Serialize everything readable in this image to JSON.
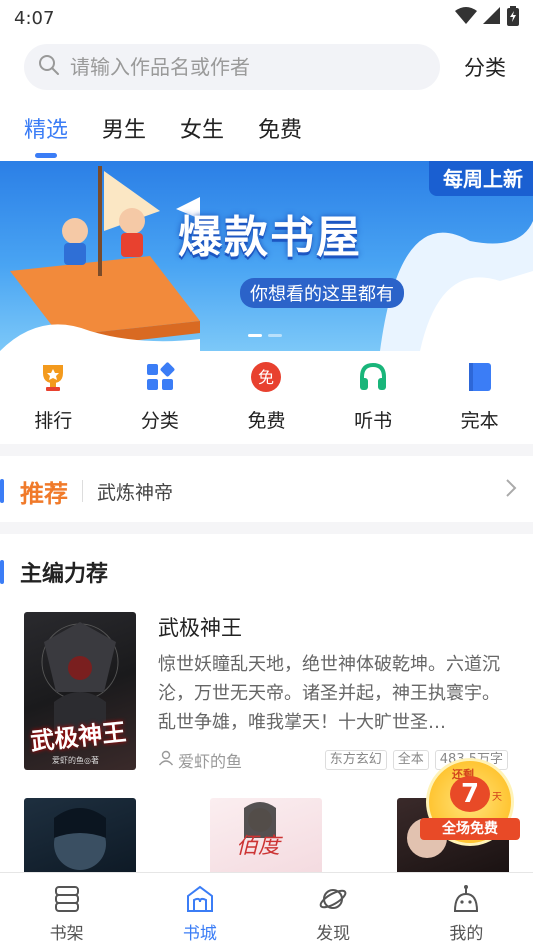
{
  "status_bar": {
    "time": "4:07"
  },
  "search": {
    "placeholder": "请输入作品名或作者",
    "category_link": "分类"
  },
  "tabs": [
    {
      "label": "精选",
      "active": true
    },
    {
      "label": "男生",
      "active": false
    },
    {
      "label": "女生",
      "active": false
    },
    {
      "label": "免费",
      "active": false
    }
  ],
  "banner": {
    "tag": "每周上新",
    "title": "爆款书屋",
    "subtitle": "你想看的这里都有",
    "page_count": 2,
    "current_page": 1
  },
  "quick_nav": [
    {
      "label": "排行",
      "icon": "trophy-icon",
      "color": "#f39a1d"
    },
    {
      "label": "分类",
      "icon": "category-grid-icon",
      "color": "#3b7df6"
    },
    {
      "label": "免费",
      "icon": "free-badge-icon",
      "color": "#e8412f"
    },
    {
      "label": "听书",
      "icon": "headphones-icon",
      "color": "#19b57a"
    },
    {
      "label": "完本",
      "icon": "book-icon",
      "color": "#3b7df6"
    }
  ],
  "recommend": {
    "label": "推荐",
    "title": "武炼神帝"
  },
  "section": {
    "title": "主编力荐"
  },
  "featured_book": {
    "title": "武极神王",
    "description": "惊世妖瞳乱天地，绝世神体破乾坤。六道沉沦，万世无天帝。诸圣并起，神王执寰宇。乱世争雄，唯我掌天！十大旷世圣…",
    "author": "爱虾的鱼",
    "tags": [
      "东方玄幻",
      "全本",
      "483.5万字"
    ],
    "cover_title": "武极神王",
    "cover_author": "爱虾的鱼◎著"
  },
  "more_covers": [
    {
      "text": ""
    },
    {
      "text": "佰度"
    },
    {
      "text": ""
    }
  ],
  "promo": {
    "top": "还剩",
    "number": "7",
    "unit": "天",
    "banner": "全场免费"
  },
  "bottom_nav": [
    {
      "label": "书架",
      "icon": "bookshelf-icon",
      "active": false
    },
    {
      "label": "书城",
      "icon": "bookstore-icon",
      "active": true
    },
    {
      "label": "发现",
      "icon": "planet-icon",
      "active": false
    },
    {
      "label": "我的",
      "icon": "profile-icon",
      "active": false
    }
  ],
  "colors": {
    "accent": "#3b7df6",
    "recommend": "#f07a2a"
  }
}
